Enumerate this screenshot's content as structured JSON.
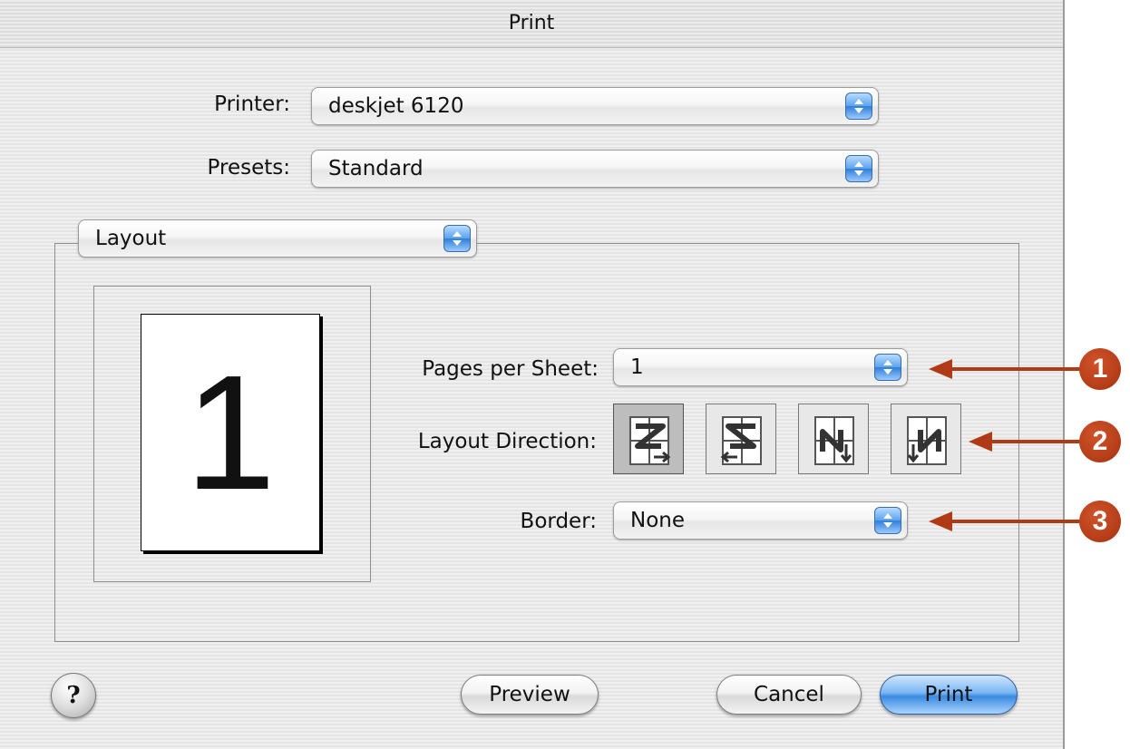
{
  "window": {
    "title": "Print"
  },
  "printer": {
    "label": "Printer:",
    "value": "deskjet 6120"
  },
  "presets": {
    "label": "Presets:",
    "value": "Standard"
  },
  "panel": {
    "value": "Layout"
  },
  "preview": {
    "page_number": "1"
  },
  "pages_per_sheet": {
    "label": "Pages per Sheet:",
    "value": "1"
  },
  "layout_direction": {
    "label": "Layout Direction:",
    "options": [
      "left-to-right-then-down",
      "right-to-left-then-down",
      "top-to-bottom-then-right",
      "top-to-bottom-then-left"
    ],
    "selected_index": 0
  },
  "border": {
    "label": "Border:",
    "value": "None"
  },
  "buttons": {
    "help": "?",
    "preview": "Preview",
    "cancel": "Cancel",
    "print": "Print"
  },
  "callouts": [
    "1",
    "2",
    "3"
  ],
  "colors": {
    "callout": "#b33c17",
    "default_button": "#3a8ae0",
    "popup_arrow": "#2f7ed8"
  },
  "icons": {
    "popup_arrows": "up-down-arrows-icon",
    "help": "help-icon"
  }
}
